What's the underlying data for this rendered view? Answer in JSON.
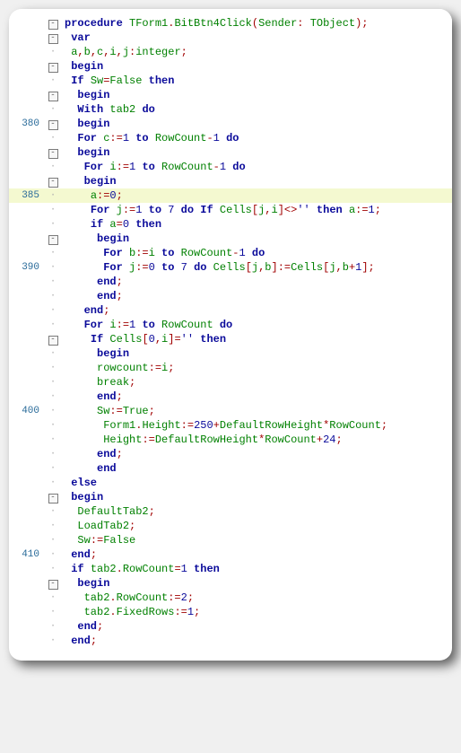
{
  "lines": [
    {
      "num": "",
      "mark": "minus",
      "indent": "",
      "hl": false,
      "tok": [
        [
          "kw",
          "procedure"
        ],
        [
          "plain",
          " "
        ],
        [
          "ident",
          "TForm1"
        ],
        [
          "sym",
          "."
        ],
        [
          "ident",
          "BitBtn4Click"
        ],
        [
          "sym",
          "("
        ],
        [
          "ident",
          "Sender"
        ],
        [
          "sym",
          ":"
        ],
        [
          "plain",
          " "
        ],
        [
          "ident",
          "TObject"
        ],
        [
          "sym",
          ");"
        ]
      ]
    },
    {
      "num": "",
      "mark": "minus",
      "indent": " ",
      "hl": false,
      "tok": [
        [
          "kw",
          "var"
        ]
      ]
    },
    {
      "num": "",
      "mark": "dot",
      "indent": " ",
      "hl": false,
      "tok": [
        [
          "ident",
          "a"
        ],
        [
          "sym",
          ","
        ],
        [
          "ident",
          "b"
        ],
        [
          "sym",
          ","
        ],
        [
          "ident",
          "c"
        ],
        [
          "sym",
          ","
        ],
        [
          "ident",
          "i"
        ],
        [
          "sym",
          ","
        ],
        [
          "ident",
          "j"
        ],
        [
          "sym",
          ":"
        ],
        [
          "ident",
          "integer"
        ],
        [
          "sym",
          ";"
        ]
      ]
    },
    {
      "num": "",
      "mark": "minus",
      "indent": " ",
      "hl": false,
      "tok": [
        [
          "kw",
          "begin"
        ]
      ]
    },
    {
      "num": "",
      "mark": "dot",
      "indent": " ",
      "hl": false,
      "tok": [
        [
          "kw",
          "If"
        ],
        [
          "plain",
          " "
        ],
        [
          "ident",
          "Sw"
        ],
        [
          "sym",
          "="
        ],
        [
          "ident",
          "False"
        ],
        [
          "plain",
          " "
        ],
        [
          "kw",
          "then"
        ]
      ]
    },
    {
      "num": "",
      "mark": "minus",
      "indent": "  ",
      "hl": false,
      "tok": [
        [
          "kw",
          "begin"
        ]
      ]
    },
    {
      "num": "",
      "mark": "dot",
      "indent": "  ",
      "hl": false,
      "tok": [
        [
          "kw",
          "With"
        ],
        [
          "plain",
          " "
        ],
        [
          "ident",
          "tab2"
        ],
        [
          "plain",
          " "
        ],
        [
          "kw",
          "do"
        ]
      ]
    },
    {
      "num": "380",
      "mark": "minus",
      "indent": "  ",
      "hl": false,
      "tok": [
        [
          "kw",
          "begin"
        ]
      ]
    },
    {
      "num": "",
      "mark": "dot",
      "indent": "  ",
      "hl": false,
      "tok": [
        [
          "kw",
          "For"
        ],
        [
          "plain",
          " "
        ],
        [
          "ident",
          "c"
        ],
        [
          "sym",
          ":="
        ],
        [
          "num",
          "1"
        ],
        [
          "plain",
          " "
        ],
        [
          "kw",
          "to"
        ],
        [
          "plain",
          " "
        ],
        [
          "ident",
          "RowCount"
        ],
        [
          "sym",
          "-"
        ],
        [
          "num",
          "1"
        ],
        [
          "plain",
          " "
        ],
        [
          "kw",
          "do"
        ]
      ]
    },
    {
      "num": "",
      "mark": "minus",
      "indent": "  ",
      "hl": false,
      "tok": [
        [
          "kw",
          "begin"
        ]
      ]
    },
    {
      "num": "",
      "mark": "dot",
      "indent": "   ",
      "hl": false,
      "tok": [
        [
          "kw",
          "For"
        ],
        [
          "plain",
          " "
        ],
        [
          "ident",
          "i"
        ],
        [
          "sym",
          ":="
        ],
        [
          "num",
          "1"
        ],
        [
          "plain",
          " "
        ],
        [
          "kw",
          "to"
        ],
        [
          "plain",
          " "
        ],
        [
          "ident",
          "RowCount"
        ],
        [
          "sym",
          "-"
        ],
        [
          "num",
          "1"
        ],
        [
          "plain",
          " "
        ],
        [
          "kw",
          "do"
        ]
      ]
    },
    {
      "num": "",
      "mark": "minus",
      "indent": "   ",
      "hl": false,
      "tok": [
        [
          "kw",
          "begin"
        ]
      ]
    },
    {
      "num": "385",
      "mark": "dot",
      "indent": "    ",
      "hl": true,
      "tok": [
        [
          "ident",
          "a"
        ],
        [
          "sym",
          ":="
        ],
        [
          "num",
          "0"
        ],
        [
          "sym",
          ";"
        ]
      ]
    },
    {
      "num": "",
      "mark": "dot",
      "indent": "    ",
      "hl": false,
      "tok": [
        [
          "kw",
          "For"
        ],
        [
          "plain",
          " "
        ],
        [
          "ident",
          "j"
        ],
        [
          "sym",
          ":="
        ],
        [
          "num",
          "1"
        ],
        [
          "plain",
          " "
        ],
        [
          "kw",
          "to"
        ],
        [
          "plain",
          " "
        ],
        [
          "num",
          "7"
        ],
        [
          "plain",
          " "
        ],
        [
          "kw",
          "do"
        ],
        [
          "plain",
          " "
        ],
        [
          "kw",
          "If"
        ],
        [
          "plain",
          " "
        ],
        [
          "ident",
          "Cells"
        ],
        [
          "sym",
          "["
        ],
        [
          "ident",
          "j"
        ],
        [
          "sym",
          ","
        ],
        [
          "ident",
          "i"
        ],
        [
          "sym",
          "]<>"
        ],
        [
          "str",
          "''"
        ],
        [
          "plain",
          " "
        ],
        [
          "kw",
          "then"
        ],
        [
          "plain",
          " "
        ],
        [
          "ident",
          "a"
        ],
        [
          "sym",
          ":="
        ],
        [
          "num",
          "1"
        ],
        [
          "sym",
          ";"
        ]
      ]
    },
    {
      "num": "",
      "mark": "dot",
      "indent": "    ",
      "hl": false,
      "tok": [
        [
          "kw",
          "if"
        ],
        [
          "plain",
          " "
        ],
        [
          "ident",
          "a"
        ],
        [
          "sym",
          "="
        ],
        [
          "num",
          "0"
        ],
        [
          "plain",
          " "
        ],
        [
          "kw",
          "then"
        ]
      ]
    },
    {
      "num": "",
      "mark": "minus",
      "indent": "     ",
      "hl": false,
      "tok": [
        [
          "kw",
          "begin"
        ]
      ]
    },
    {
      "num": "",
      "mark": "dot",
      "indent": "      ",
      "hl": false,
      "tok": [
        [
          "kw",
          "For"
        ],
        [
          "plain",
          " "
        ],
        [
          "ident",
          "b"
        ],
        [
          "sym",
          ":="
        ],
        [
          "ident",
          "i"
        ],
        [
          "plain",
          " "
        ],
        [
          "kw",
          "to"
        ],
        [
          "plain",
          " "
        ],
        [
          "ident",
          "RowCount"
        ],
        [
          "sym",
          "-"
        ],
        [
          "num",
          "1"
        ],
        [
          "plain",
          " "
        ],
        [
          "kw",
          "do"
        ]
      ]
    },
    {
      "num": "390",
      "mark": "dot",
      "indent": "      ",
      "hl": false,
      "tok": [
        [
          "kw",
          "For"
        ],
        [
          "plain",
          " "
        ],
        [
          "ident",
          "j"
        ],
        [
          "sym",
          ":="
        ],
        [
          "num",
          "0"
        ],
        [
          "plain",
          " "
        ],
        [
          "kw",
          "to"
        ],
        [
          "plain",
          " "
        ],
        [
          "num",
          "7"
        ],
        [
          "plain",
          " "
        ],
        [
          "kw",
          "do"
        ],
        [
          "plain",
          " "
        ],
        [
          "ident",
          "Cells"
        ],
        [
          "sym",
          "["
        ],
        [
          "ident",
          "j"
        ],
        [
          "sym",
          ","
        ],
        [
          "ident",
          "b"
        ],
        [
          "sym",
          "]:="
        ],
        [
          "ident",
          "Cells"
        ],
        [
          "sym",
          "["
        ],
        [
          "ident",
          "j"
        ],
        [
          "sym",
          ","
        ],
        [
          "ident",
          "b"
        ],
        [
          "sym",
          "+"
        ],
        [
          "num",
          "1"
        ],
        [
          "sym",
          "];"
        ]
      ]
    },
    {
      "num": "",
      "mark": "dot",
      "indent": "     ",
      "hl": false,
      "tok": [
        [
          "kw",
          "end"
        ],
        [
          "sym",
          ";"
        ]
      ]
    },
    {
      "num": "",
      "mark": "dot",
      "indent": "     ",
      "hl": false,
      "tok": [
        [
          "kw",
          "end"
        ],
        [
          "sym",
          ";"
        ]
      ]
    },
    {
      "num": "",
      "mark": "dot",
      "indent": "   ",
      "hl": false,
      "tok": [
        [
          "kw",
          "end"
        ],
        [
          "sym",
          ";"
        ]
      ]
    },
    {
      "num": "",
      "mark": "dot",
      "indent": "   ",
      "hl": false,
      "tok": [
        [
          "kw",
          "For"
        ],
        [
          "plain",
          " "
        ],
        [
          "ident",
          "i"
        ],
        [
          "sym",
          ":="
        ],
        [
          "num",
          "1"
        ],
        [
          "plain",
          " "
        ],
        [
          "kw",
          "to"
        ],
        [
          "plain",
          " "
        ],
        [
          "ident",
          "RowCount"
        ],
        [
          "plain",
          " "
        ],
        [
          "kw",
          "do"
        ]
      ]
    },
    {
      "num": "",
      "mark": "minus",
      "indent": "    ",
      "hl": false,
      "tok": [
        [
          "kw",
          "If"
        ],
        [
          "plain",
          " "
        ],
        [
          "ident",
          "Cells"
        ],
        [
          "sym",
          "["
        ],
        [
          "num",
          "0"
        ],
        [
          "sym",
          ","
        ],
        [
          "ident",
          "i"
        ],
        [
          "sym",
          "]="
        ],
        [
          "str",
          "''"
        ],
        [
          "plain",
          " "
        ],
        [
          "kw",
          "then"
        ]
      ]
    },
    {
      "num": "",
      "mark": "dot",
      "indent": "     ",
      "hl": false,
      "tok": [
        [
          "kw",
          "begin"
        ]
      ]
    },
    {
      "num": "",
      "mark": "dot",
      "indent": "     ",
      "hl": false,
      "tok": [
        [
          "ident",
          "rowcount"
        ],
        [
          "sym",
          ":="
        ],
        [
          "ident",
          "i"
        ],
        [
          "sym",
          ";"
        ]
      ]
    },
    {
      "num": "",
      "mark": "dot",
      "indent": "     ",
      "hl": false,
      "tok": [
        [
          "ident",
          "break"
        ],
        [
          "sym",
          ";"
        ]
      ]
    },
    {
      "num": "",
      "mark": "dot",
      "indent": "     ",
      "hl": false,
      "tok": [
        [
          "kw",
          "end"
        ],
        [
          "sym",
          ";"
        ]
      ]
    },
    {
      "num": "400",
      "mark": "dot",
      "indent": "     ",
      "hl": false,
      "tok": [
        [
          "ident",
          "Sw"
        ],
        [
          "sym",
          ":="
        ],
        [
          "ident",
          "True"
        ],
        [
          "sym",
          ";"
        ]
      ]
    },
    {
      "num": "",
      "mark": "dot",
      "indent": "      ",
      "hl": false,
      "tok": [
        [
          "ident",
          "Form1"
        ],
        [
          "sym",
          "."
        ],
        [
          "ident",
          "Height"
        ],
        [
          "sym",
          ":="
        ],
        [
          "num",
          "250"
        ],
        [
          "sym",
          "+"
        ],
        [
          "ident",
          "DefaultRowHeight"
        ],
        [
          "sym",
          "*"
        ],
        [
          "ident",
          "RowCount"
        ],
        [
          "sym",
          ";"
        ]
      ]
    },
    {
      "num": "",
      "mark": "dot",
      "indent": "      ",
      "hl": false,
      "tok": [
        [
          "ident",
          "Height"
        ],
        [
          "sym",
          ":="
        ],
        [
          "ident",
          "DefaultRowHeight"
        ],
        [
          "sym",
          "*"
        ],
        [
          "ident",
          "RowCount"
        ],
        [
          "sym",
          "+"
        ],
        [
          "num",
          "24"
        ],
        [
          "sym",
          ";"
        ]
      ]
    },
    {
      "num": "",
      "mark": "dot",
      "indent": "     ",
      "hl": false,
      "tok": [
        [
          "kw",
          "end"
        ],
        [
          "sym",
          ";"
        ]
      ]
    },
    {
      "num": "",
      "mark": "dot",
      "indent": "     ",
      "hl": false,
      "tok": [
        [
          "kw",
          "end"
        ]
      ]
    },
    {
      "num": "",
      "mark": "dot",
      "indent": " ",
      "hl": false,
      "tok": [
        [
          "kw",
          "else"
        ]
      ]
    },
    {
      "num": "",
      "mark": "minus",
      "indent": " ",
      "hl": false,
      "tok": [
        [
          "kw",
          "begin"
        ]
      ]
    },
    {
      "num": "",
      "mark": "dot",
      "indent": "  ",
      "hl": false,
      "tok": [
        [
          "ident",
          "DefaultTab2"
        ],
        [
          "sym",
          ";"
        ]
      ]
    },
    {
      "num": "",
      "mark": "dot",
      "indent": "  ",
      "hl": false,
      "tok": [
        [
          "ident",
          "LoadTab2"
        ],
        [
          "sym",
          ";"
        ]
      ]
    },
    {
      "num": "",
      "mark": "dot",
      "indent": "  ",
      "hl": false,
      "tok": [
        [
          "ident",
          "Sw"
        ],
        [
          "sym",
          ":="
        ],
        [
          "ident",
          "False"
        ]
      ]
    },
    {
      "num": "410",
      "mark": "dot",
      "indent": " ",
      "hl": false,
      "tok": [
        [
          "kw",
          "end"
        ],
        [
          "sym",
          ";"
        ]
      ]
    },
    {
      "num": "",
      "mark": "dot",
      "indent": " ",
      "hl": false,
      "tok": [
        [
          "kw",
          "if"
        ],
        [
          "plain",
          " "
        ],
        [
          "ident",
          "tab2"
        ],
        [
          "sym",
          "."
        ],
        [
          "ident",
          "RowCount"
        ],
        [
          "sym",
          "="
        ],
        [
          "num",
          "1"
        ],
        [
          "plain",
          " "
        ],
        [
          "kw",
          "then"
        ]
      ]
    },
    {
      "num": "",
      "mark": "minus",
      "indent": "  ",
      "hl": false,
      "tok": [
        [
          "kw",
          "begin"
        ]
      ]
    },
    {
      "num": "",
      "mark": "dot",
      "indent": "   ",
      "hl": false,
      "tok": [
        [
          "ident",
          "tab2"
        ],
        [
          "sym",
          "."
        ],
        [
          "ident",
          "RowCount"
        ],
        [
          "sym",
          ":="
        ],
        [
          "num",
          "2"
        ],
        [
          "sym",
          ";"
        ]
      ]
    },
    {
      "num": "",
      "mark": "dot",
      "indent": "   ",
      "hl": false,
      "tok": [
        [
          "ident",
          "tab2"
        ],
        [
          "sym",
          "."
        ],
        [
          "ident",
          "FixedRows"
        ],
        [
          "sym",
          ":="
        ],
        [
          "num",
          "1"
        ],
        [
          "sym",
          ";"
        ]
      ]
    },
    {
      "num": "",
      "mark": "dot",
      "indent": "  ",
      "hl": false,
      "tok": [
        [
          "kw",
          "end"
        ],
        [
          "sym",
          ";"
        ]
      ]
    },
    {
      "num": "",
      "mark": "dot",
      "indent": " ",
      "hl": false,
      "tok": [
        [
          "kw",
          "end"
        ],
        [
          "sym",
          ";"
        ]
      ]
    }
  ]
}
